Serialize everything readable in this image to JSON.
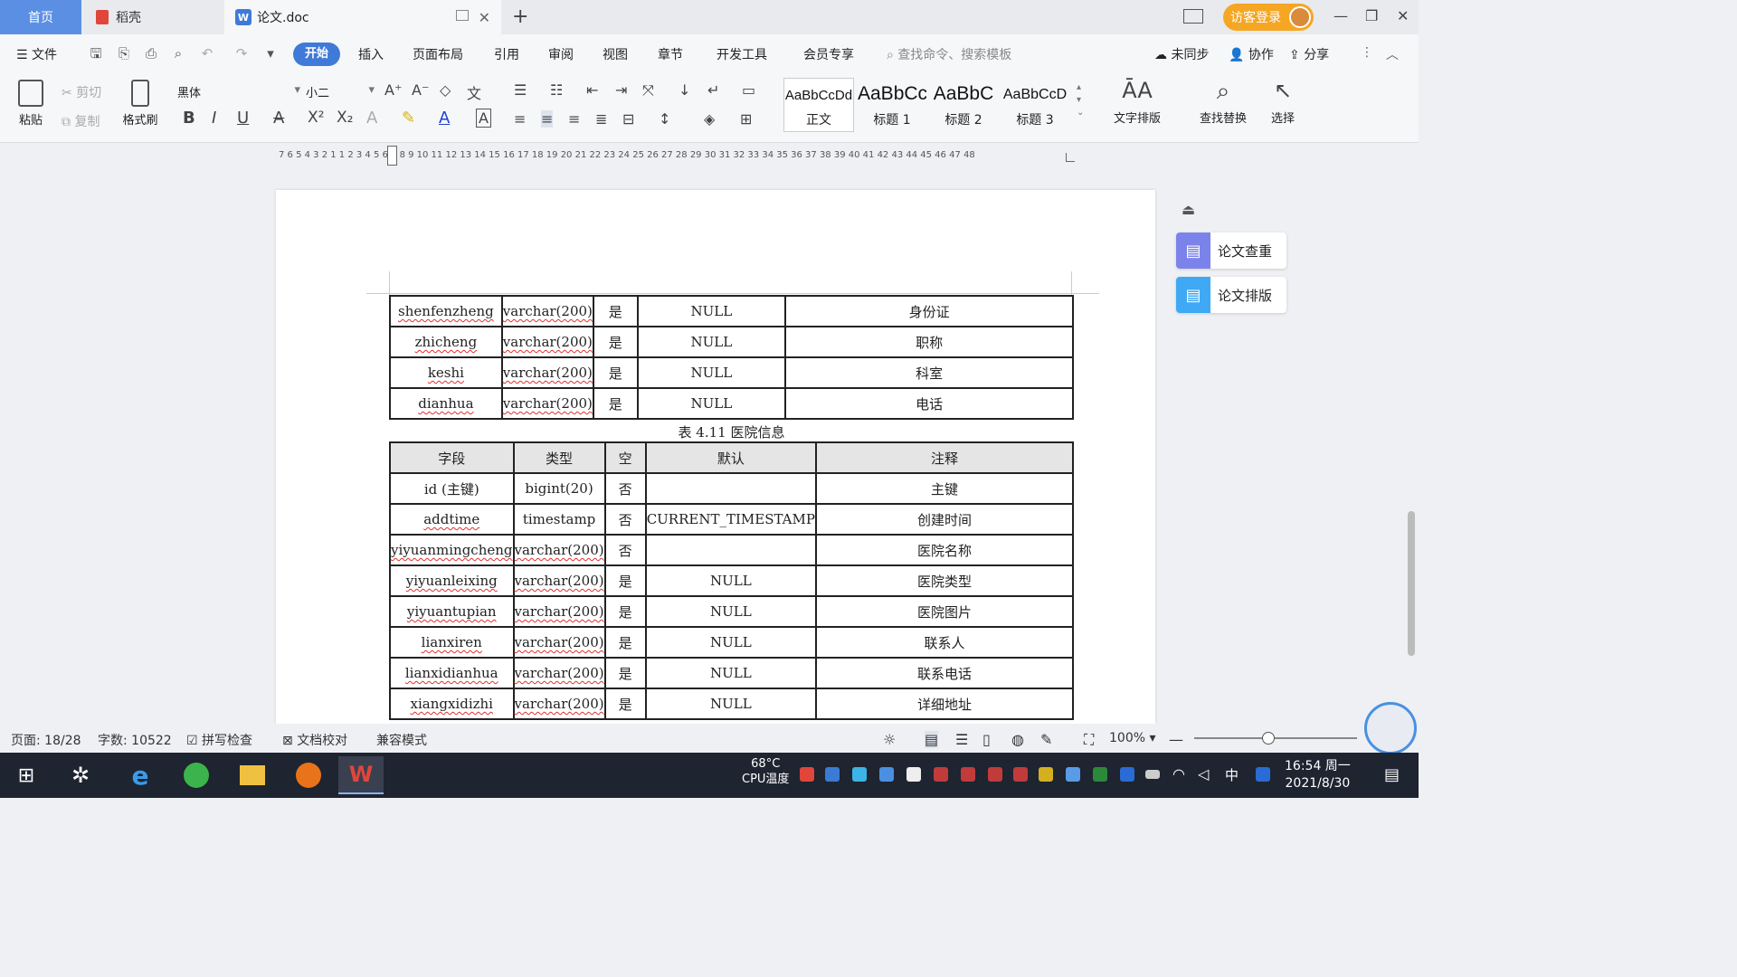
{
  "tabs": {
    "home": "首页",
    "daoke": "稻壳",
    "doc": "论文.doc",
    "doc_icon": "W"
  },
  "titlebar": {
    "visitor_login": "访客登录"
  },
  "menu": {
    "file": "文件",
    "items": [
      "开始",
      "插入",
      "页面布局",
      "引用",
      "审阅",
      "视图",
      "章节",
      "开发工具",
      "会员专享"
    ],
    "search_cmd": "查找命令、搜索模板",
    "unsync": "未同步",
    "collab": "协作",
    "share": "分享"
  },
  "ribbon": {
    "paste": "粘贴",
    "cut": "剪切",
    "copy": "复制",
    "format_painter": "格式刷",
    "font_name": "黑体",
    "font_size": "小二",
    "styles": [
      {
        "preview": "AaBbCcDd",
        "name": "正文"
      },
      {
        "preview": "AaBbCc",
        "name": "标题 1"
      },
      {
        "preview": "AaBbC",
        "name": "标题 2"
      },
      {
        "preview": "AaBbCcD",
        "name": "标题 3"
      }
    ],
    "text_layout": "文字排版",
    "find_replace": "查找替换",
    "select": "选择"
  },
  "ruler": {
    "ticks": "7  6  5  4  3  2  1     1  2  3  4  5  6  7  8  9 10 11 12 13 14 15 16 17 18 19 20 21 22 23 24 25 26 27 28 29 30 31 32 33 34 35 36 37 38 39 40 41 42 43 44 45 46 47 48"
  },
  "table_top": {
    "rows": [
      [
        "shenfenzheng",
        "varchar(200)",
        "是",
        "NULL",
        "身份证"
      ],
      [
        "zhicheng",
        "varchar(200)",
        "是",
        "NULL",
        "职称"
      ],
      [
        "keshi",
        "varchar(200)",
        "是",
        "NULL",
        "科室"
      ],
      [
        "dianhua",
        "varchar(200)",
        "是",
        "NULL",
        "电话"
      ]
    ]
  },
  "caption": "表 4.11  医院信息",
  "table_main": {
    "headers": [
      "字段",
      "类型",
      "空",
      "默认",
      "注释"
    ],
    "rows": [
      [
        "id (主键)",
        "bigint(20)",
        "否",
        "",
        "主键"
      ],
      [
        "addtime",
        "timestamp",
        "否",
        "CURRENT_TIMESTAMP",
        "创建时间"
      ],
      [
        "yiyuanmingcheng",
        "varchar(200)",
        "否",
        "",
        "医院名称"
      ],
      [
        "yiyuanleixing",
        "varchar(200)",
        "是",
        "NULL",
        "医院类型"
      ],
      [
        "yiyuantupian",
        "varchar(200)",
        "是",
        "NULL",
        "医院图片"
      ],
      [
        "lianxiren",
        "varchar(200)",
        "是",
        "NULL",
        "联系人"
      ],
      [
        "lianxidianhua",
        "varchar(200)",
        "是",
        "NULL",
        "联系电话"
      ],
      [
        "xiangxidizhi",
        "varchar(200)",
        "是",
        "NULL",
        "详细地址"
      ]
    ]
  },
  "side": {
    "check": "论文查重",
    "layout": "论文排版"
  },
  "status": {
    "page": "页面: 18/28",
    "words": "字数: 10522",
    "spell": "拼写检查",
    "proof": "文档校对",
    "compat": "兼容模式",
    "zoom": "100%"
  },
  "taskbar": {
    "temp": "68°C",
    "temp_label": "CPU温度",
    "ime": "中",
    "time": "16:54 周一",
    "date": "2021/8/30"
  },
  "colors": {
    "accent": "#3f7ad8",
    "visitor": "#f5a623",
    "side_check": "#7b83eb",
    "side_layout": "#3fa9f5"
  }
}
